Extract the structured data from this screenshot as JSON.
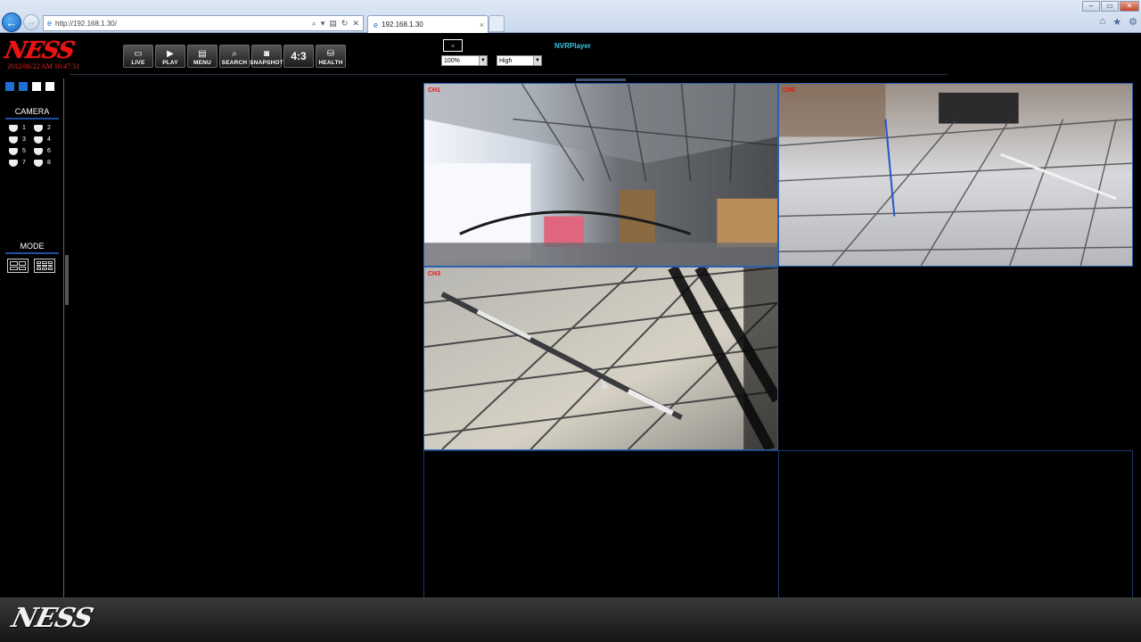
{
  "browser": {
    "url": "http://192.168.1.30/",
    "tab_title": "192.168.1.30",
    "tab_close": "×",
    "address_tools": [
      "⌕",
      "▾",
      "▤",
      "↻",
      "✕"
    ],
    "win_buttons": [
      "–",
      "▭",
      "✕"
    ],
    "tool_icons": [
      "⌂",
      "★",
      "⚙"
    ]
  },
  "header": {
    "logo_text": "NESS",
    "datetime": "2012/06/22 AM 10:47:51",
    "toolbar": [
      {
        "id": "live",
        "label": "LIVE",
        "icon": "tv-icon",
        "glyph": "▭"
      },
      {
        "id": "play",
        "label": "PLAY",
        "icon": "play-icon",
        "glyph": "▶"
      },
      {
        "id": "menu",
        "label": "MENU",
        "icon": "menu-icon",
        "glyph": "▤"
      },
      {
        "id": "search",
        "label": "SEARCH",
        "icon": "search-icon",
        "glyph": "⌕"
      },
      {
        "id": "snapshot",
        "label": "SNAPSHOT",
        "icon": "camera-icon",
        "glyph": "◙"
      },
      {
        "id": "aspect",
        "label": "4:3",
        "icon": "",
        "glyph": ""
      },
      {
        "id": "health",
        "label": "HEALTH",
        "icon": "hdd-icon",
        "glyph": "⛁"
      }
    ],
    "zoom_value": "100%",
    "quality_value": "High",
    "player_name": "NVRPlayer"
  },
  "sidebar": {
    "camera_title": "CAMERA",
    "cameras": [
      "1",
      "2",
      "3",
      "4",
      "5",
      "6",
      "7",
      "8"
    ],
    "mode_title": "MODE",
    "icon_colors": [
      "#1e6fd6",
      "#1e6fd6",
      "#ffffff",
      "#ffffff"
    ]
  },
  "tiles": [
    {
      "label": "CH1",
      "has_video": true
    },
    {
      "label": "CH2",
      "has_video": true
    },
    {
      "label": "CH3",
      "has_video": true
    },
    {
      "label": "",
      "has_video": false
    }
  ],
  "footer": {
    "logo_text": "NESS"
  },
  "colors": {
    "brand_red": "#e11111",
    "accent_blue": "#2a5fb0",
    "player_cyan": "#35c9e6"
  }
}
